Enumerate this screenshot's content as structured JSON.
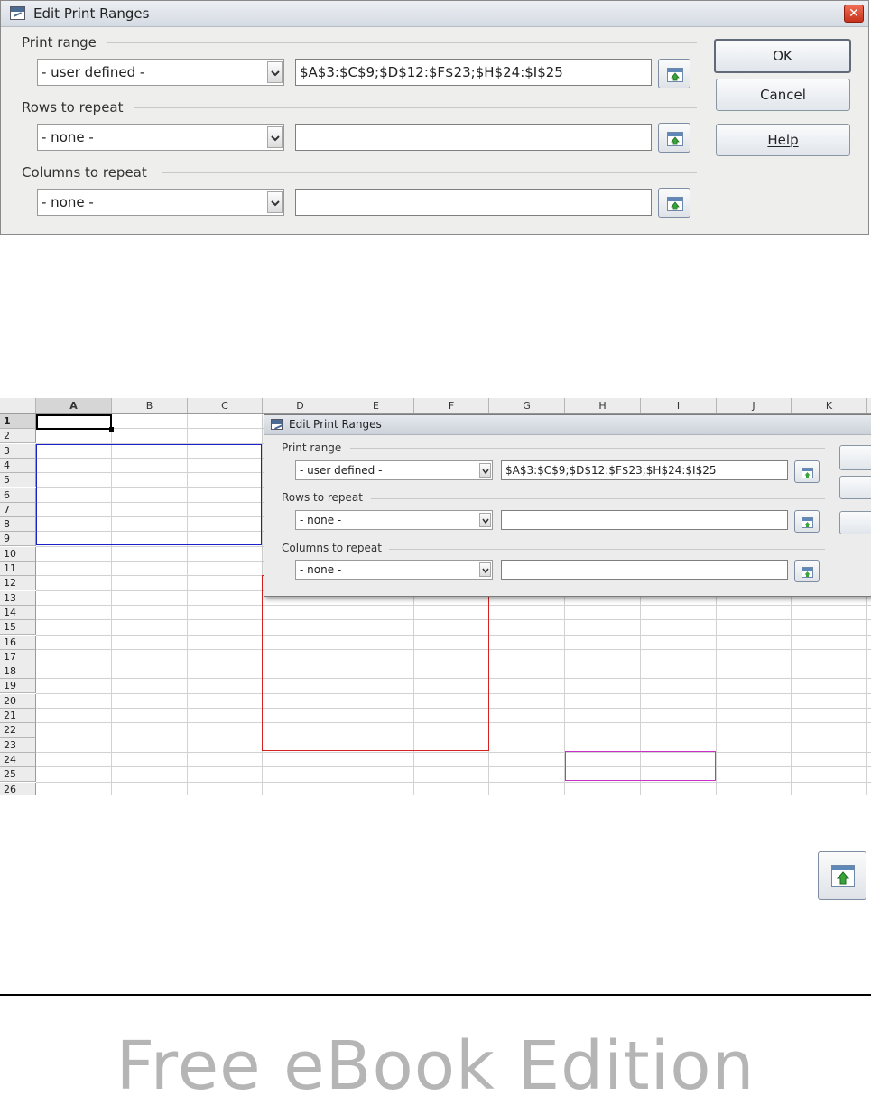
{
  "dialog": {
    "title": "Edit Print Ranges",
    "close_glyph": "✕",
    "print_range": {
      "label": "Print range",
      "selected": "- user defined -",
      "value": "$A$3:$C$9;$D$12:$F$23;$H$24:$I$25"
    },
    "rows_to_repeat": {
      "label": "Rows to repeat",
      "selected": "- none -",
      "value": ""
    },
    "columns_to_repeat": {
      "label": "Columns to repeat",
      "selected": "- none -",
      "value": ""
    },
    "buttons": {
      "ok": "OK",
      "cancel": "Cancel",
      "help": "Help"
    },
    "icons": {
      "title": "app-window-icon",
      "shrink": "shrink-dialog-icon",
      "dropdown": "chevron-down-icon"
    }
  },
  "spreadsheet": {
    "columns": [
      "A",
      "B",
      "C",
      "D",
      "E",
      "F",
      "G",
      "H",
      "I",
      "J",
      "K"
    ],
    "rows": [
      "1",
      "2",
      "3",
      "4",
      "5",
      "6",
      "7",
      "8",
      "9",
      "10",
      "11",
      "12",
      "13",
      "14",
      "15",
      "16",
      "17",
      "18",
      "19",
      "20",
      "21",
      "22",
      "23",
      "24",
      "25",
      "26"
    ],
    "active_cell": "A1",
    "range_colors": {
      "first": "#1a22c8",
      "second": "#d82020",
      "third": "#c830c8"
    }
  },
  "footer": {
    "watermark": "Free eBook Edition"
  }
}
